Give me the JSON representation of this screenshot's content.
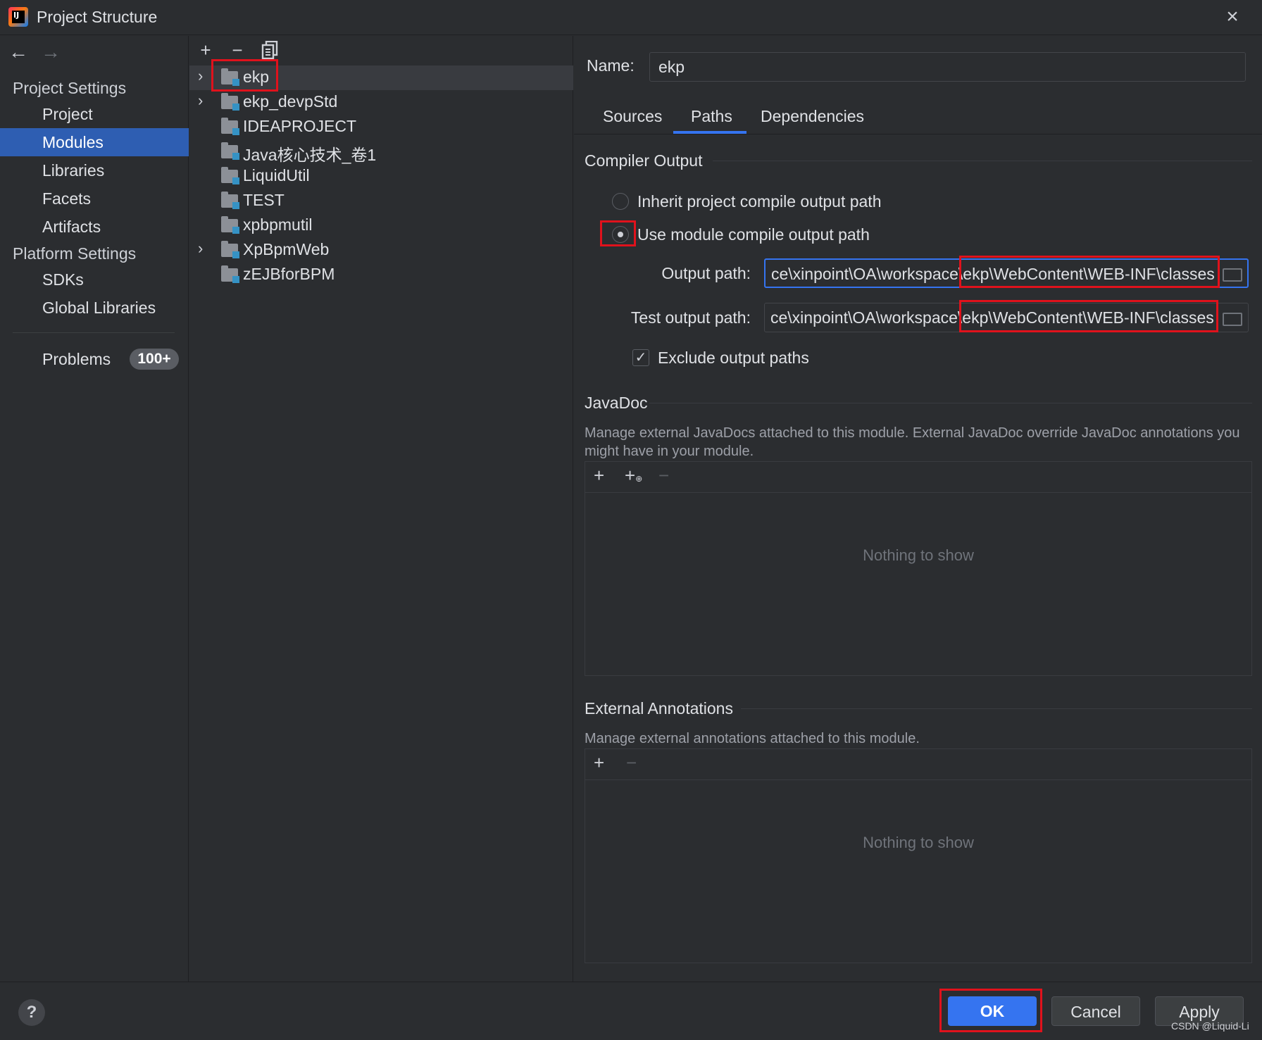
{
  "window": {
    "title": "Project Structure",
    "close_icon": "close-icon",
    "app_icon": "intellij-idea-icon"
  },
  "nav": {
    "back_icon": "arrow-left-icon",
    "forward_icon": "arrow-right-icon",
    "project_settings_header": "Project Settings",
    "project_settings_items": [
      "Project",
      "Modules",
      "Libraries",
      "Facets",
      "Artifacts"
    ],
    "selected": "Modules",
    "platform_settings_header": "Platform Settings",
    "platform_settings_items": [
      "SDKs",
      "Global Libraries"
    ],
    "problems_label": "Problems",
    "problems_badge": "100+"
  },
  "tree": {
    "toolbar": [
      "add-icon",
      "remove-icon",
      "copy-icon"
    ],
    "items": [
      {
        "label": "ekp",
        "expandable": true,
        "selected": true
      },
      {
        "label": "ekp_devpStd",
        "expandable": true
      },
      {
        "label": "IDEAPROJECT",
        "expandable": false
      },
      {
        "label": "Java核心技术_卷1",
        "expandable": false
      },
      {
        "label": "LiquidUtil",
        "expandable": false
      },
      {
        "label": "TEST",
        "expandable": false
      },
      {
        "label": "xpbpmutil",
        "expandable": false
      },
      {
        "label": "XpBpmWeb",
        "expandable": true
      },
      {
        "label": "zEJBforBPM",
        "expandable": false
      }
    ]
  },
  "module": {
    "name_label": "Name:",
    "name_value": "ekp",
    "tabs": [
      "Sources",
      "Paths",
      "Dependencies"
    ],
    "active_tab": "Paths",
    "compiler_output": {
      "title": "Compiler Output",
      "inherit_label": "Inherit project compile output path",
      "use_module_label": "Use module compile output path",
      "selected_option": "use_module",
      "output_path_label": "Output path:",
      "output_path_value": "ce\\xinpoint\\OA\\workspace\\ekp\\WebContent\\WEB-INF\\classes",
      "test_output_path_label": "Test output path:",
      "test_output_path_value": "ce\\xinpoint\\OA\\workspace\\ekp\\WebContent\\WEB-INF\\classes",
      "exclude_label": "Exclude output paths",
      "exclude_checked": true
    },
    "javadoc": {
      "title": "JavaDoc",
      "description": "Manage external JavaDocs attached to this module. External JavaDoc override JavaDoc annotations you might have in your module.",
      "empty_text": "Nothing to show"
    },
    "annotations": {
      "title": "External Annotations",
      "description": "Manage external annotations attached to this module.",
      "empty_text": "Nothing to show"
    }
  },
  "footer": {
    "help_label": "?",
    "ok_label": "OK",
    "cancel_label": "Cancel",
    "apply_label": "Apply",
    "watermark": "CSDN @Liquid-Li"
  },
  "colors": {
    "background": "#2b2d30",
    "selection": "#2e5eb2",
    "accent": "#3574f0",
    "annotation_red": "#e0121c"
  }
}
